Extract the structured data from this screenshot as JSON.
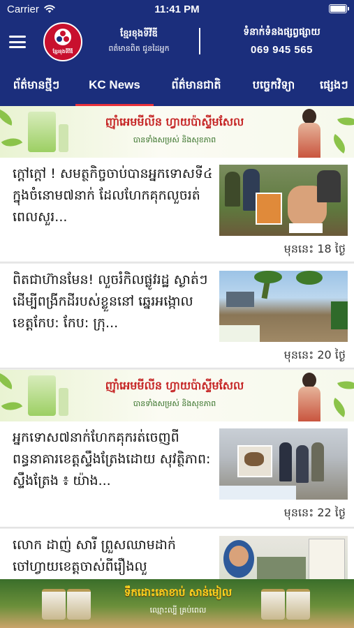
{
  "status_bar": {
    "carrier": "Carrier",
    "time": "11:41 PM"
  },
  "header": {
    "logo_text": "ខ្មែរខុងទីវីឌី",
    "brand_name": "ខ្មែរខុងទីវីឌី",
    "brand_slogan": "ពត៌មានពិត ជូនដៃអ្នក",
    "contact_label": "ទំនាក់ទំនងផ្សព្វផ្សាយ",
    "contact_phone": "069 945 565",
    "background_color": "#1b2e7c",
    "active_tab_underline_color": "#e9323b"
  },
  "tabs": [
    {
      "label": "ព័ត៌មានថ្មីៗ",
      "active": false
    },
    {
      "label": "KC News",
      "active": true
    },
    {
      "label": "ព័ត៌មានជាតិ",
      "active": false
    },
    {
      "label": "បច្ចេកវិទ្យា",
      "active": false
    },
    {
      "label": "ផ្សេងៗ",
      "active": false
    }
  ],
  "ads": {
    "top": {
      "title": "ញ៉ាំអេមមីលីន ហ្វាយប៉ាស្ទីមសែល",
      "subtitle": "បានទាំងសម្រស់ និងសុខភាព"
    },
    "middle": {
      "title": "ញ៉ាំអេមមីលីន ហ្វាយប៉ាស្ទីមសែល",
      "subtitle": "បានទាំងសម្រស់ និងសុខភាព"
    },
    "bottom": {
      "title": "ទឹកដោះគោខាប់ សាន់មៀល",
      "subtitle": "ឈ្មោះល្បី គ្រប់ពេល"
    }
  },
  "articles": [
    {
      "headline": "ក្ដៅក្ដៅ ! សមត្ថកិច្ចចាប់បានអ្នកទោសទី៤ ក្នុងចំនោម៧នាក់ ដែលហែកគុកលួចរត់ ពេលសួរ...",
      "timestamp": "មុននេះ 18 ថ្ងៃ"
    },
    {
      "headline": "ពិតជាហ៊ានមែន! លួចរំកិលផ្លូវរដ្ឋ ស្ងាត់ៗដើម្បីពង្រីកដីរបស់ខ្លួននៅ ឆ្នេរអង្កោល ខេត្តកែប: កែប: ក្រុ...",
      "timestamp": "មុននេះ 20 ថ្ងៃ"
    },
    {
      "headline": "អ្នកទោស៧នាក់ហែកគុករត់ចេញពីពន្ធនាគារខេត្តស្ទឹងត្រែងដោយ សុវត្ថិភាព: ស្ទឹងត្រែង ៖ យ៉ាង...",
      "timestamp": "មុននេះ 22 ថ្ងៃ"
    },
    {
      "headline": "លោក ដាញ់ សារី ព្រួសឈាមដាក់ ចៅហ្វាយខេត្តចាស់ពីរឿងលួ",
      "timestamp": ""
    }
  ]
}
